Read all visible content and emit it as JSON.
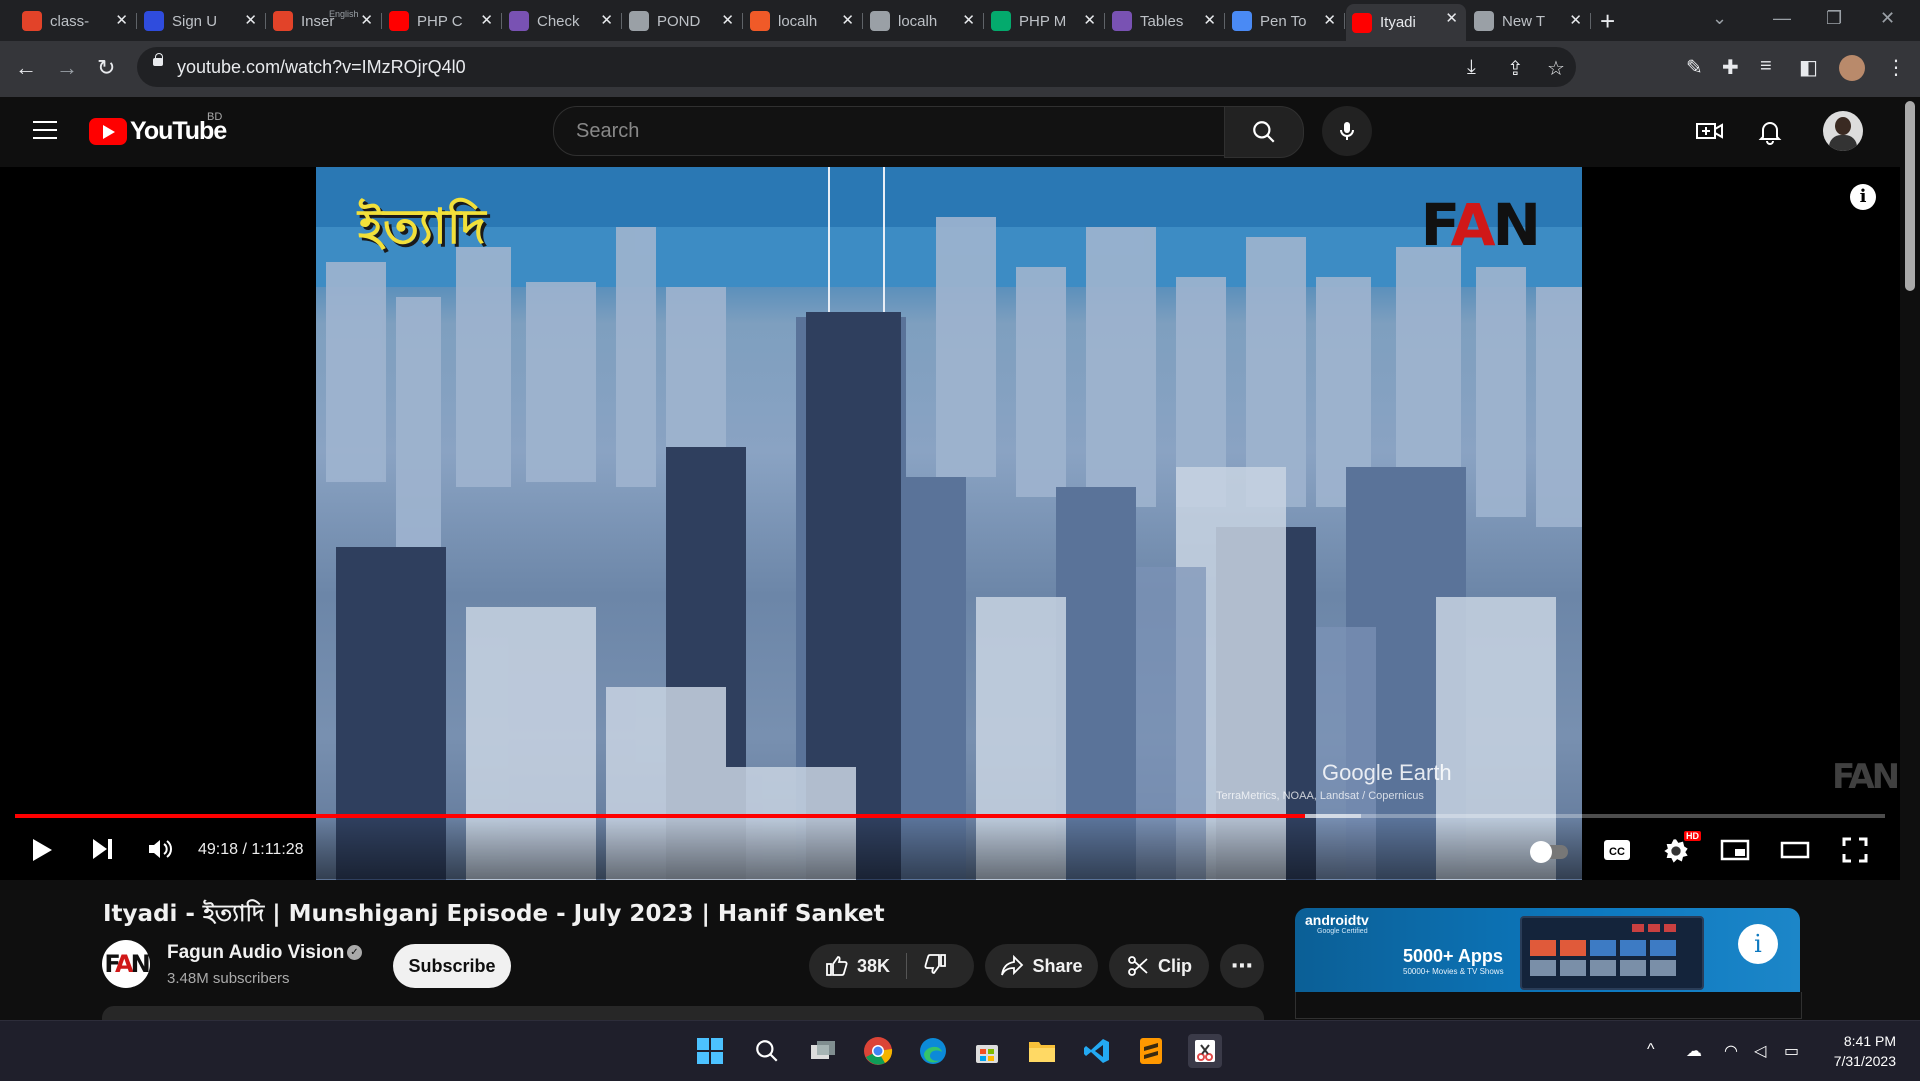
{
  "browser": {
    "tabs": [
      {
        "title": "class-",
        "icon": "gitlab-icon",
        "color": "#e24329"
      },
      {
        "title": "Sign U",
        "icon": "m-icon",
        "color": "#2f4cdd"
      },
      {
        "title": "Inser",
        "overlay": "English",
        "icon": "gitlab-icon",
        "color": "#e24329"
      },
      {
        "title": "PHP C",
        "icon": "youtube-icon",
        "color": "#ff0000"
      },
      {
        "title": "Check",
        "icon": "bootstrap-icon",
        "color": "#7952b3"
      },
      {
        "title": "POND",
        "icon": "globe-icon",
        "color": "#9aa0a6"
      },
      {
        "title": "localh",
        "icon": "localhost-icon",
        "color": "#f05a28"
      },
      {
        "title": "localh",
        "icon": "globe-icon",
        "color": "#9aa0a6"
      },
      {
        "title": "PHP M",
        "icon": "w3-icon",
        "color": "#04aa6d"
      },
      {
        "title": "Tables",
        "icon": "bootstrap-icon",
        "color": "#7952b3"
      },
      {
        "title": "Pen To",
        "icon": "flag-icon",
        "color": "#4a8af4"
      },
      {
        "title": "Ityadi",
        "icon": "youtube-icon",
        "color": "#ff0000",
        "active": true
      },
      {
        "title": "New T",
        "icon": "chrome-icon",
        "color": "#9aa0a6"
      }
    ],
    "url": "youtube.com/watch?v=IMzROjrQ4l0"
  },
  "youtube": {
    "logo_text": "YouTube",
    "country_code": "BD",
    "search_placeholder": "Search"
  },
  "player": {
    "logo_overlay": "ইত্যাদি",
    "brand_overlay": "FAN",
    "watermark_text": "Google Earth",
    "watermark_credit": "TerraMetrics, NOAA, Landsat / Copernicus",
    "corner_watermark": "FAN",
    "time_current": "49:18",
    "time_total": "1:11:28",
    "time_display": "49:18 / 1:11:28",
    "progress_fraction": 0.69,
    "buffer_fraction": 0.72,
    "quality_badge": "HD",
    "info_glyph": "i"
  },
  "video": {
    "title": "Ityadi - ইত্যাদি | Munshiganj Episode - July 2023 | Hanif Sanket",
    "channel": {
      "name": "Fagun Audio Vision",
      "subscribers": "3.48M subscribers",
      "avatar_text": "FAN"
    },
    "actions": {
      "subscribe": "Subscribe",
      "likes": "38K",
      "share": "Share",
      "clip": "Clip"
    }
  },
  "ad": {
    "brand": "androidtv",
    "brand_sub": "Google Certified",
    "headline": "5000+ Apps",
    "sub": "50000+ Movies & TV Shows"
  },
  "taskbar": {
    "apps": [
      "windows-start-icon",
      "search-icon",
      "task-view-icon",
      "chrome-icon",
      "edge-icon",
      "store-icon",
      "file-explorer-icon",
      "vscode-icon",
      "sublime-icon",
      "snipping-tool-icon"
    ],
    "time": "8:41 PM",
    "date": "7/31/2023"
  },
  "colors": {
    "youtube_red": "#ff0000",
    "background": "#0f0f0f",
    "chrome_frame": "#202124",
    "chrome_toolbar": "#35363a"
  }
}
